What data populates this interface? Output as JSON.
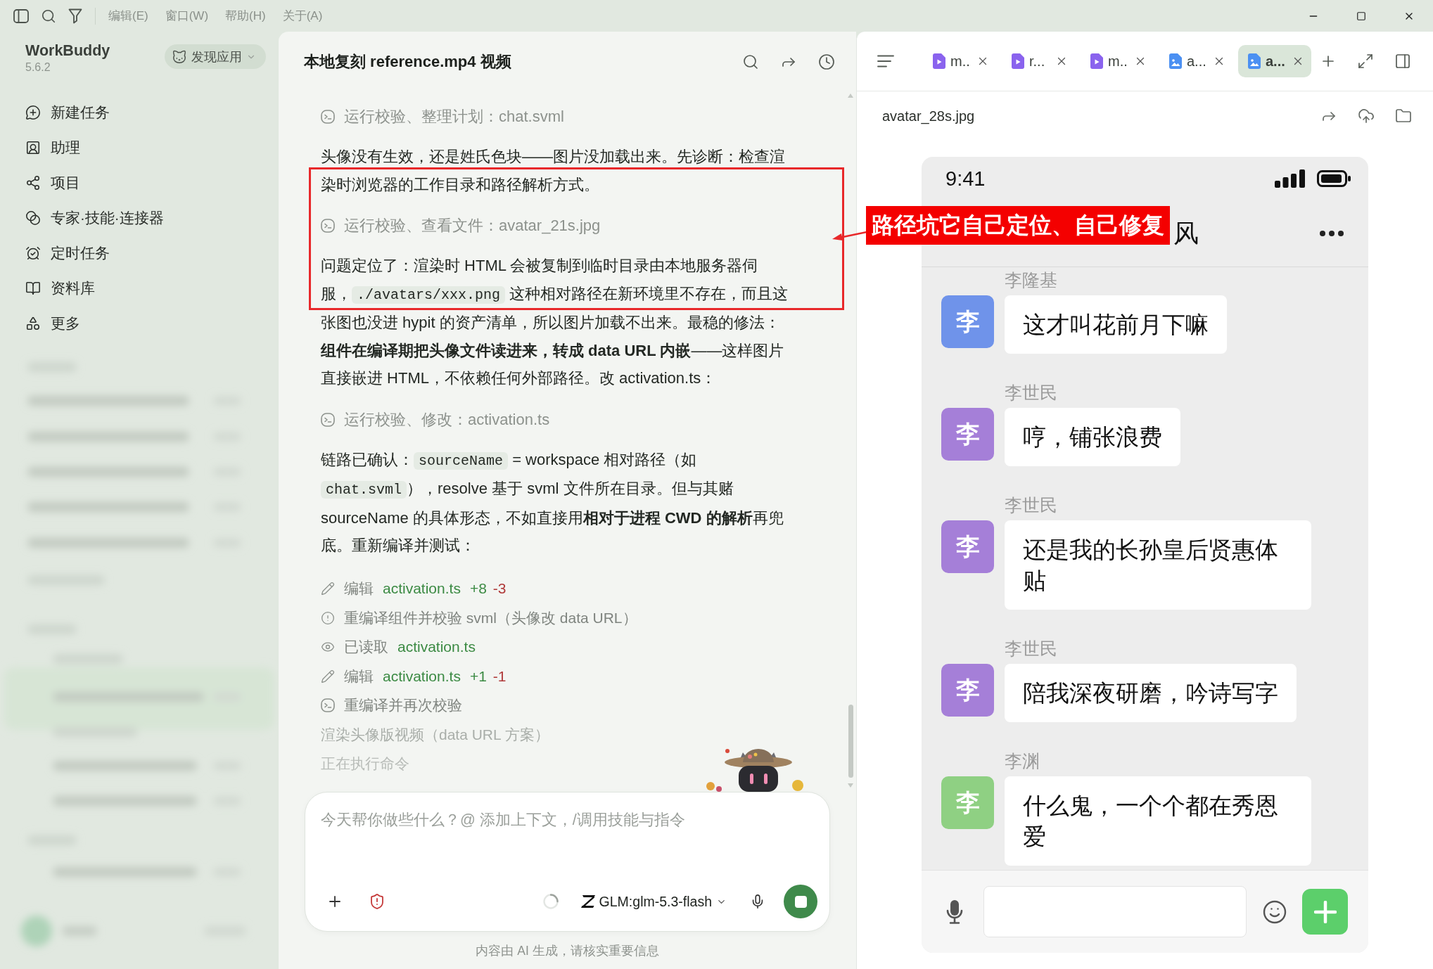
{
  "menu_bar": {
    "menus": [
      "编辑(E)",
      "窗口(W)",
      "帮助(H)",
      "关于(A)"
    ]
  },
  "sidebar": {
    "app_name": "WorkBuddy",
    "version": "5.6.2",
    "discover_button": "发现应用",
    "items": [
      "新建任务",
      "助理",
      "项目",
      "专家·技能·连接器",
      "定时任务",
      "资料库",
      "更多"
    ]
  },
  "chat": {
    "title": "本地复刻 reference.mp4 视频",
    "blocks": [
      {
        "kind": "tool",
        "text": "运行校验、整理计划：chat.svml"
      },
      {
        "kind": "paragraph",
        "segments": [
          {
            "kind": "text",
            "text": "头像没有生效，还是姓氏色块——图片没加载出来。先诊断：检查渲染时浏览器的工作目录和路径解析方式。"
          }
        ]
      },
      {
        "kind": "tool",
        "text": "运行校验、查看文件：avatar_21s.jpg"
      },
      {
        "kind": "paragraph",
        "segments": [
          {
            "kind": "text",
            "text": "问题定位了：渲染时 HTML 会被复制到临时目录由本地服务器伺服，"
          },
          {
            "kind": "code",
            "text": "./avatars/xxx.png"
          },
          {
            "kind": "text",
            "text": " 这种相对路径在新环境里不存在，而且这张图也没进 hypit 的资产清单，所以图片加载不出来。最稳的修法：**组件在编译期把头像文件读进来，转成 data URL 内嵌**——这样图片直接嵌进 HTML，不依赖任何外部路径。改 activation.ts："
          }
        ]
      },
      {
        "kind": "tool",
        "text": "运行校验、修改：activation.ts"
      },
      {
        "kind": "paragraph",
        "segments": [
          {
            "kind": "text",
            "text": "链路已确认："
          },
          {
            "kind": "code",
            "text": "sourceName"
          },
          {
            "kind": "text",
            "text": " = workspace 相对路径（如 "
          },
          {
            "kind": "code",
            "text": "chat.svml"
          },
          {
            "kind": "text",
            "text": "），resolve 基于 svml 文件所在目录。但与其赌 sourceName 的具体形态，不如直接用**相对于进程 CWD 的解析**再兜底。重新编译并测试："
          }
        ]
      },
      {
        "kind": "steps",
        "items": [
          {
            "kind": "edit",
            "action": "编辑",
            "file": "activation.ts",
            "added": "+8",
            "removed": "-3"
          },
          {
            "kind": "check",
            "text": "重编译组件并校验 svml（头像改 data URL）"
          },
          {
            "kind": "read",
            "action": "已读取",
            "file": "activation.ts"
          },
          {
            "kind": "edit",
            "action": "编辑",
            "file": "activation.ts",
            "added": "+1",
            "removed": "-1"
          },
          {
            "kind": "command",
            "text": "重编译并再次校验"
          },
          {
            "kind": "pending",
            "text": "渲染头像版视频（data URL 方案）"
          },
          {
            "kind": "status",
            "text": "正在执行命令"
          }
        ]
      }
    ],
    "composer": {
      "placeholder": "今天帮你做些什么？@ 添加上下文，/调用技能与指令",
      "model": "GLM:glm-5.3-flash",
      "running": true
    },
    "disclaimer": "内容由 AI 生成，请核实重要信息"
  },
  "preview": {
    "tabs": [
      {
        "kind": "video",
        "label": "m..",
        "selected": false
      },
      {
        "kind": "video",
        "label": "r...",
        "selected": false
      },
      {
        "kind": "video",
        "label": "m..",
        "selected": false
      },
      {
        "kind": "image",
        "label": "a...",
        "selected": false
      },
      {
        "kind": "image",
        "label": "a...",
        "selected": true
      }
    ],
    "file_name": "avatar_28s.jpg",
    "image": {
      "time": "9:41",
      "chat_title": "风",
      "messages": [
        {
          "sender": "李隆基",
          "avatar": "李",
          "color": "#6f93ea",
          "text": "这才叫花前月下嘛"
        },
        {
          "sender": "李世民",
          "avatar": "李",
          "color": "#a57fd8",
          "text": "哼，铺张浪费"
        },
        {
          "sender": "李世民",
          "avatar": "李",
          "color": "#a57fd8",
          "text": "还是我的长孙皇后贤惠体贴"
        },
        {
          "sender": "李世民",
          "avatar": "李",
          "color": "#a57fd8",
          "text": "陪我深夜研磨，吟诗写字"
        },
        {
          "sender": "李渊",
          "avatar": "李",
          "color": "#8fd083",
          "text": "什么鬼，一个个都在秀恩爱"
        }
      ]
    }
  },
  "annotation": {
    "label": "路径坑它自己定位、自己修复"
  }
}
